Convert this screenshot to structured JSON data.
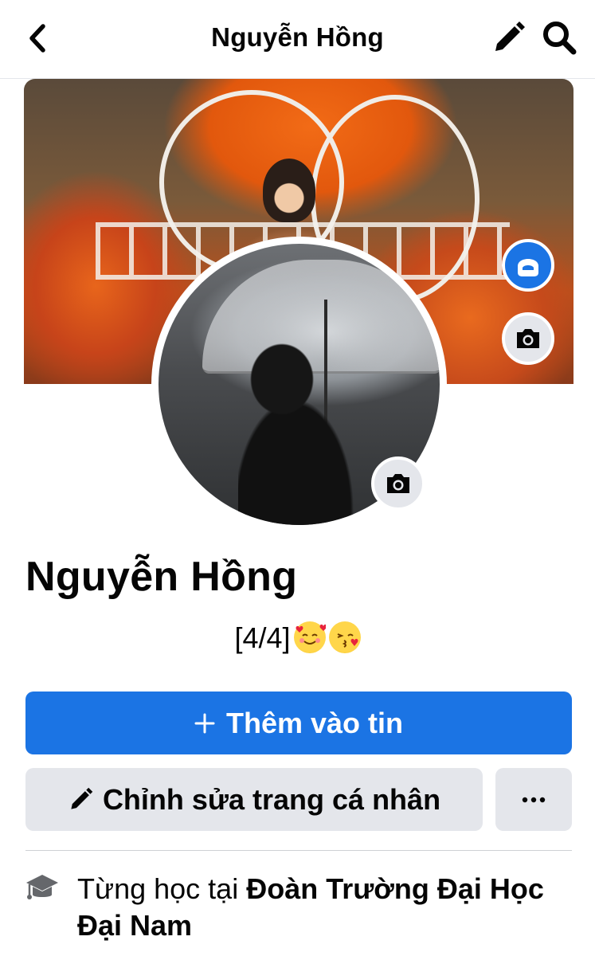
{
  "header": {
    "title": "Nguyễn Hồng",
    "back_icon": "chevron-left-icon",
    "edit_icon": "pencil-icon",
    "search_icon": "search-icon"
  },
  "cover": {
    "avatar_button_icon": "avatar-icon",
    "camera_button_icon": "camera-icon"
  },
  "profile": {
    "name": "Nguyễn Hồng",
    "bio_text": "[4/4]",
    "bio_emojis": [
      "smiling-face-with-hearts",
      "face-blowing-kiss"
    ]
  },
  "actions": {
    "add_story_icon": "plus-icon",
    "add_story_label": "Thêm vào tin",
    "edit_profile_icon": "pencil-icon",
    "edit_profile_label": "Chỉnh sửa trang cá nhân",
    "more_icon": "more-horizontal-icon"
  },
  "details": {
    "education_icon": "graduation-cap-icon",
    "education_prefix": "Từng học tại ",
    "education_school": "Đoàn Trường Đại Học Đại Nam"
  },
  "colors": {
    "primary": "#1b74e4",
    "secondary_bg": "#e4e6eb",
    "text": "#050505"
  }
}
